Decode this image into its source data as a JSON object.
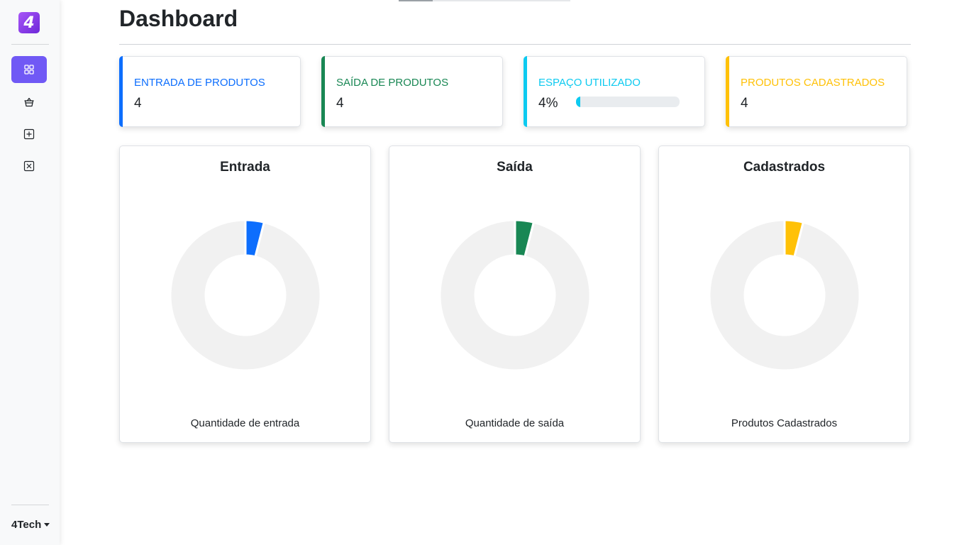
{
  "app": {
    "logo_text": "4",
    "user_menu_label": "4Tech"
  },
  "sidebar": {
    "items": [
      {
        "name": "dashboard",
        "icon": "grid-icon",
        "active": true
      },
      {
        "name": "basket",
        "icon": "basket-icon",
        "active": false
      },
      {
        "name": "add",
        "icon": "plus-square-icon",
        "active": false
      },
      {
        "name": "remove",
        "icon": "x-square-icon",
        "active": false
      }
    ]
  },
  "page": {
    "title": "Dashboard"
  },
  "stats": [
    {
      "label": "ENTRADA DE PRODUTOS",
      "value": "4",
      "color": "#0d6efd"
    },
    {
      "label": "SAÍDA DE PRODUTOS",
      "value": "4",
      "color": "#198754"
    },
    {
      "label": "ESPAÇO UTILIZADO",
      "value": "4%",
      "color": "#0dcaf0",
      "progress": 0.04
    },
    {
      "label": "PRODUTOS CADASTRADOS",
      "value": "4",
      "color": "#ffc107"
    }
  ],
  "chart_data": [
    {
      "type": "pie",
      "title": "Entrada",
      "caption": "Quantidade de entrada",
      "categories": [
        "Quantidade de entrada",
        ""
      ],
      "values": [
        4,
        96
      ],
      "colors": [
        "#0d6efd",
        "#f1f1f1"
      ],
      "donut": true
    },
    {
      "type": "pie",
      "title": "Saída",
      "caption": "Quantidade de saída",
      "categories": [
        "Quantidade de saída",
        ""
      ],
      "values": [
        4,
        96
      ],
      "colors": [
        "#198754",
        "#f1f1f1"
      ],
      "donut": true
    },
    {
      "type": "pie",
      "title": "Cadastrados",
      "caption": "Produtos Cadastrados",
      "categories": [
        "Produtos Cadastrados",
        ""
      ],
      "values": [
        4,
        96
      ],
      "colors": [
        "#ffc107",
        "#f1f1f1"
      ],
      "donut": true
    }
  ]
}
